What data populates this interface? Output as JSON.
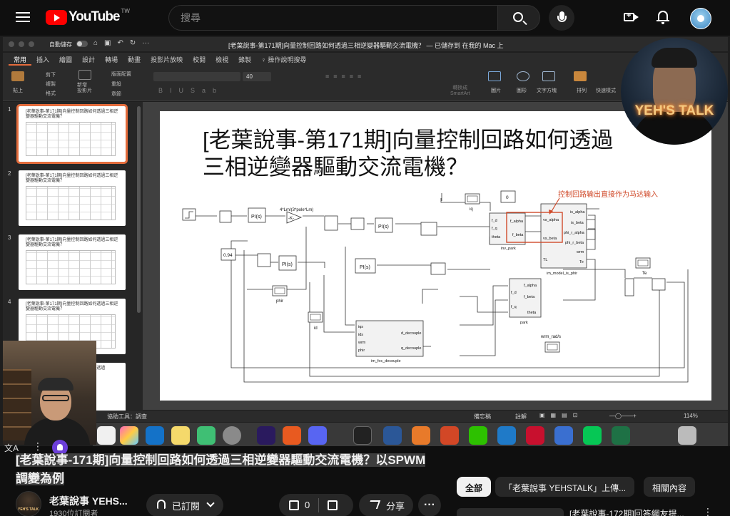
{
  "header": {
    "logo_text": "YouTube",
    "region_badge": "TW",
    "search_placeholder": "搜尋"
  },
  "player": {
    "window": {
      "autosave_label": "自動儲存",
      "doc_title": "[老葉說事-第171期]向量控制回路如何透過三相逆變器驅動交流電機？ — 已儲存到 在我的 Mac 上"
    },
    "menu_tabs": [
      "常用",
      "插入",
      "繪圖",
      "設計",
      "轉場",
      "動畫",
      "投影片放映",
      "校閱",
      "檢視",
      "錄製",
      "♀ 操作說明搜尋"
    ],
    "ribbon": {
      "paste": "貼上",
      "cut": "剪下",
      "copy": "複製",
      "format": "格式",
      "new_slide": "新增\n投影片",
      "layout": "版面配置",
      "reset": "重設",
      "section": "章節",
      "font_size": "40",
      "smartart": "轉換成\nSmartArt",
      "picture": "圖片",
      "shape": "圖形",
      "textbox": "文字方塊",
      "arrange": "排列",
      "quick_styles": "快速樣式"
    },
    "thumbnails": [
      {
        "num": "1",
        "title": "[老葉說事-第171期]向量控制回路如何透過三相逆變器驅動交流電機？"
      },
      {
        "num": "2",
        "title": "[老葉說事-第171期]向量控制回路如何透過三相逆變器驅動交流電機？"
      },
      {
        "num": "3",
        "title": "[老葉說事-第171期]向量控制回路如何透過三相逆變器驅動交流電機？"
      },
      {
        "num": "4",
        "title": "[老葉說事-第171期]向量控制回路如何透過三相逆變器驅動交流電機？"
      },
      {
        "num": "",
        "title": "[老葉說事-第171期]向量控制回路如何透過"
      }
    ],
    "slide": {
      "title_line1": "[老葉說事-第171期]向量控制回路如何透過",
      "title_line2": "三相逆變器驅動交流電機？",
      "annotation": "控制回路输出直接作为马达输入",
      "gain_label": "4*Lm/(3*pole*Lm)",
      "gain_block": "-K-",
      "const_094": "0.94",
      "const_0": "0",
      "pi_label": "PI(s)",
      "blocks": {
        "inv_park": "inv_park",
        "im_model": "im_model_is_phir",
        "park": "park",
        "foc": "im_foc_decouple",
        "scope_iq": "iq",
        "scope_id": "id",
        "scope_phir": "phir",
        "scope_te": "Te",
        "wrm_label": "wrm_rad/s"
      },
      "ports": {
        "inv_park_in": [
          "f_d",
          "f_q",
          "theta"
        ],
        "inv_park_out": [
          "f_alpha",
          "f_beta"
        ],
        "model_in": [
          "vs_alpha",
          "vs_beta",
          "TL"
        ],
        "model_out": [
          "is_alpha",
          "is_beta",
          "phi_r_alpha",
          "phi_r_beta",
          "wrm",
          "Te"
        ],
        "park_in": [
          "f_alpha",
          "f_beta",
          "theta"
        ],
        "park_out": [
          "f_d",
          "f_q"
        ],
        "foc_in": [
          "iqs",
          "ids",
          "wrm",
          "phir"
        ],
        "foc_out": [
          "d_decouple",
          "q_decouple"
        ]
      }
    },
    "status": {
      "assist": "協助工具：調查",
      "notes": "備忘稿",
      "comments": "註解",
      "zoom": "114%"
    },
    "overlay_brand": "YEH'S TALK"
  },
  "video": {
    "title": "[老葉說事-171期]向量控制回路如何透過三相逆變器驅動交流電機？以SPWM調變為例",
    "channel_name": "老葉說事 YEHS...",
    "subscribers": "1930位訂閱者",
    "subscribe_label": "已訂閱",
    "likes": "0",
    "share_label": "分享",
    "more_label": "···"
  },
  "sidebar": {
    "chips": [
      "全部",
      "「老葉說事 YEHSTALK」上傳...",
      "相關內容"
    ],
    "rec_title": "[老葉說事-172期]回答網友提..."
  }
}
